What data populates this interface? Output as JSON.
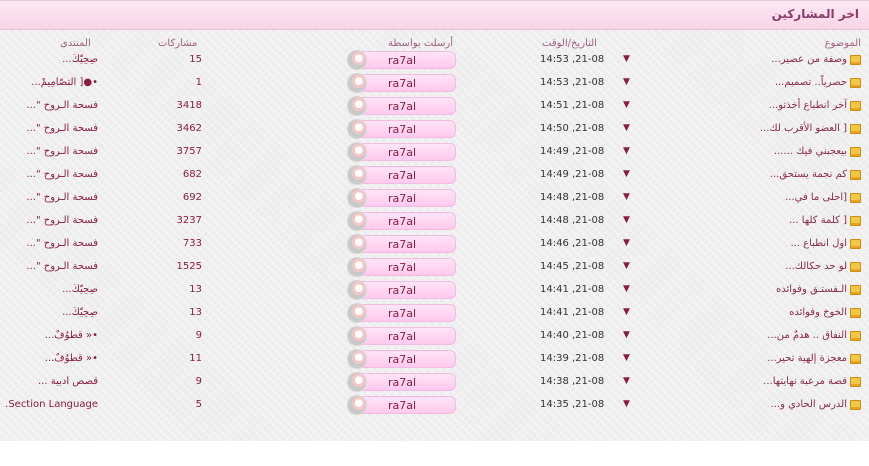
{
  "title": "اخر المشاركين",
  "headers": {
    "topic": "الموضوع",
    "datetime": "التاريخ/الوقت",
    "sent_by": "أرسلت بواسطة",
    "posts": "مشاركات",
    "forum": "المنتدى"
  },
  "rows": [
    {
      "topic": "وصفة من عصير...",
      "date": "14:53 ,21-08",
      "user": "ra7al",
      "posts": "15",
      "forum": "صِحِيّكَ..."
    },
    {
      "topic": "حصرياً.. تصميم...",
      "date": "14:53 ,21-08",
      "user": "ra7al",
      "posts": "1",
      "forum": "•●[ التصّامِيمْ..."
    },
    {
      "topic": "آخر انطباع أخذتو...",
      "date": "14:51 ,21-08",
      "user": "ra7al",
      "posts": "3418",
      "forum": "فسحة الـروح \"..."
    },
    {
      "topic": "[ العضو الأقرب لك...",
      "date": "14:50 ,21-08",
      "user": "ra7al",
      "posts": "3462",
      "forum": "فسحة الـروح \"..."
    },
    {
      "topic": "بيعجبني فيك ......",
      "date": "14:49 ,21-08",
      "user": "ra7al",
      "posts": "3757",
      "forum": "فسحة الـروح \"..."
    },
    {
      "topic": "كم نجمة يستحق...",
      "date": "14:49 ,21-08",
      "user": "ra7al",
      "posts": "682",
      "forum": "فسحة الـروح \"..."
    },
    {
      "topic": "[احلى ما في...",
      "date": "14:48 ,21-08",
      "user": "ra7al",
      "posts": "692",
      "forum": "فسحة الـروح \"..."
    },
    {
      "topic": "[ كلمة كلها ...",
      "date": "14:48 ,21-08",
      "user": "ra7al",
      "posts": "3237",
      "forum": "فسحة الـروح \"..."
    },
    {
      "topic": "اول انطباع ...",
      "date": "14:46 ,21-08",
      "user": "ra7al",
      "posts": "733",
      "forum": "فسحة الـروح \"..."
    },
    {
      "topic": "لو حد حكالك...",
      "date": "14:45 ,21-08",
      "user": "ra7al",
      "posts": "1525",
      "forum": "فسحة الـروح \"..."
    },
    {
      "topic": "الـفستـق وفوائده",
      "date": "14:41 ,21-08",
      "user": "ra7al",
      "posts": "13",
      "forum": "صِحِيّكَ..."
    },
    {
      "topic": "الخوخ وفوائده",
      "date": "14:41 ,21-08",
      "user": "ra7al",
      "posts": "13",
      "forum": "صِحِيّكَ..."
    },
    {
      "topic": "النفاق .. هدمٌ من...",
      "date": "14:40 ,21-08",
      "user": "ra7al",
      "posts": "9",
      "forum": "•« قطوُفٌ..."
    },
    {
      "topic": "معجزة إلهية تحير...",
      "date": "14:39 ,21-08",
      "user": "ra7al",
      "posts": "11",
      "forum": "•« قطوُفٌ..."
    },
    {
      "topic": "قصة مرعبة نهايتها...",
      "date": "14:38 ,21-08",
      "user": "ra7al",
      "posts": "9",
      "forum": "قصص أدبية ..."
    },
    {
      "topic": "الدرس الحادي و...",
      "date": "14:35 ,21-08",
      "user": "ra7al",
      "posts": "5",
      "forum": "Section Language..."
    }
  ],
  "arrow_glyph": "▼",
  "colors": {
    "accent": "#8a1d3f",
    "title": "#8a3b6b",
    "user_bg": "#ffd6f2"
  }
}
